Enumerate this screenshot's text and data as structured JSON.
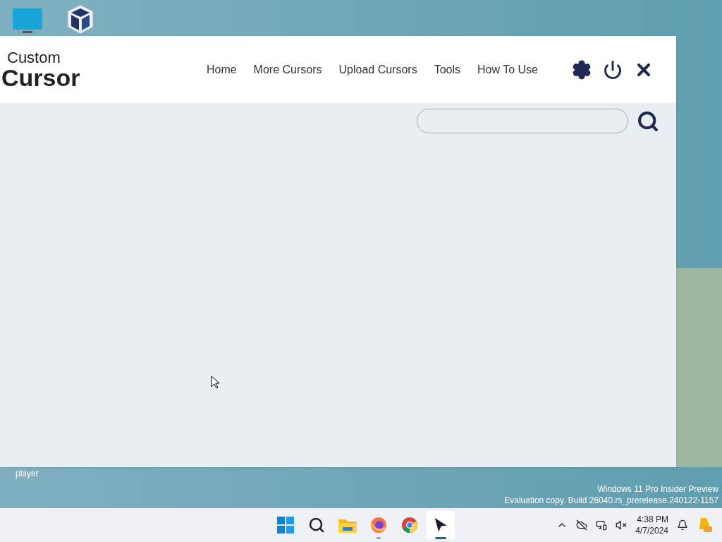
{
  "desktop": {
    "icon_label": "player"
  },
  "app": {
    "logo": {
      "line_1": "Custom",
      "line_2": "Cursor"
    },
    "nav": [
      {
        "label": "Home"
      },
      {
        "label": "More Cursors"
      },
      {
        "label": "Upload Cursors"
      },
      {
        "label": "Tools"
      },
      {
        "label": "How To Use"
      }
    ],
    "actions": [
      {
        "kind": "settings"
      },
      {
        "kind": "power"
      },
      {
        "kind": "close"
      }
    ]
  },
  "watermark": [
    "Windows 11 Pro Insider Preview",
    "Evaluation copy. Build 26040.rs_prerelease.240122-1157"
  ],
  "taskbar": {
    "apps": [
      {
        "kind": "start",
        "open": false,
        "selected": false
      },
      {
        "kind": "search",
        "open": false,
        "selected": false
      },
      {
        "kind": "folder",
        "open": false,
        "selected": false
      },
      {
        "kind": "firefox",
        "open": true,
        "selected": false
      },
      {
        "kind": "chrome",
        "open": false,
        "selected": false
      },
      {
        "kind": "cursor",
        "open": true,
        "selected": true
      }
    ],
    "time": "4:38 PM",
    "date": "4/7/2024"
  }
}
